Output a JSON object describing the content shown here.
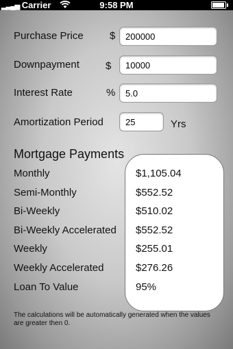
{
  "status": {
    "carrier": "Carrier",
    "time": "9:58 PM"
  },
  "form": {
    "purchase_price": {
      "label": "Purchase Price",
      "unit": "$",
      "value": "200000"
    },
    "downpayment": {
      "label": "Downpayment",
      "unit": "$",
      "value": "10000"
    },
    "interest_rate": {
      "label": "Interest Rate",
      "unit": "%",
      "value": "5.0"
    },
    "amortization": {
      "label": "Amortization Period",
      "value": "25",
      "unit": "Yrs"
    }
  },
  "payments": {
    "title": "Mortgage Payments",
    "rows": [
      {
        "label": "Monthly",
        "value": "$1,105.04"
      },
      {
        "label": "Semi-Monthly",
        "value": "$552.52"
      },
      {
        "label": "Bi-Weekly",
        "value": "$510.02"
      },
      {
        "label": "Bi-Weekly Accelerated",
        "value": "$552.52"
      },
      {
        "label": "Weekly",
        "value": "$255.01"
      },
      {
        "label": "Weekly Accelerated",
        "value": "$276.26"
      },
      {
        "label": "Loan To Value",
        "value": "95%"
      }
    ]
  },
  "footnote": "The calculations will be automatically generated when the values are greater then 0."
}
